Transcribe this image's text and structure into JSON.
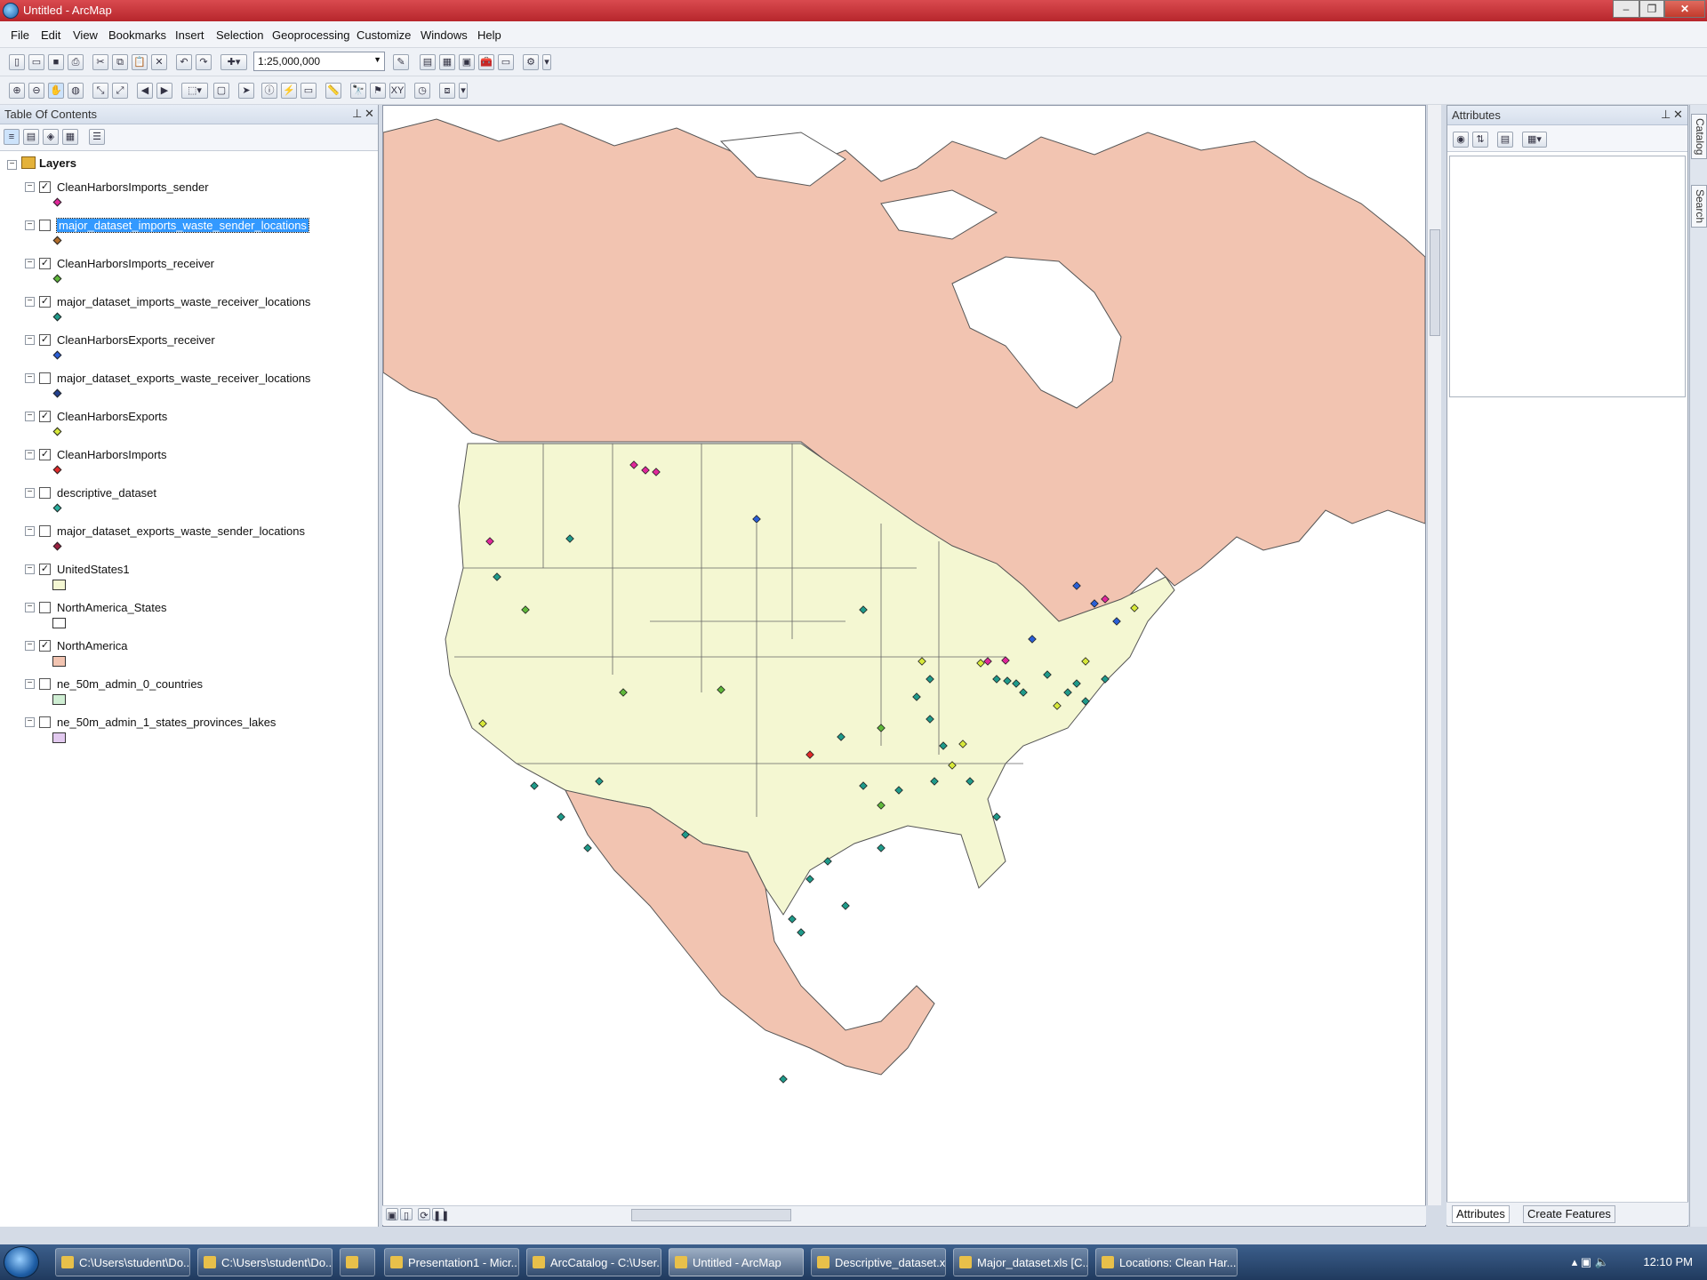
{
  "window": {
    "title": "Untitled - ArcMap"
  },
  "menu": [
    "File",
    "Edit",
    "View",
    "Bookmarks",
    "Insert",
    "Selection",
    "Geoprocessing",
    "Customize",
    "Windows",
    "Help"
  ],
  "toolbar": {
    "scale": "1:25,000,000"
  },
  "toc": {
    "title": "Table Of Contents",
    "root": "Layers",
    "layers": [
      {
        "name": "CleanHarborsImports_sender",
        "checked": true,
        "symbol": "point",
        "color": "#e0279a"
      },
      {
        "name": "major_dataset_imports_waste_sender_locations",
        "checked": false,
        "symbol": "point",
        "color": "#b06c2a",
        "selected": true
      },
      {
        "name": "CleanHarborsImports_receiver",
        "checked": true,
        "symbol": "point",
        "color": "#5fb83a"
      },
      {
        "name": "major_dataset_imports_waste_receiver_locations",
        "checked": true,
        "symbol": "point",
        "color": "#1f9a8a"
      },
      {
        "name": "CleanHarborsExports_receiver",
        "checked": true,
        "symbol": "point",
        "color": "#2a5fd6"
      },
      {
        "name": "major_dataset_exports_waste_receiver_locations",
        "checked": false,
        "symbol": "point",
        "color": "#23408f"
      },
      {
        "name": "CleanHarborsExports",
        "checked": true,
        "symbol": "point",
        "color": "#d7e83a"
      },
      {
        "name": "CleanHarborsImports",
        "checked": true,
        "symbol": "point",
        "color": "#e02a2a"
      },
      {
        "name": "descriptive_dataset",
        "checked": false,
        "symbol": "point",
        "color": "#2ab0a0"
      },
      {
        "name": "major_dataset_exports_waste_sender_locations",
        "checked": false,
        "symbol": "point",
        "color": "#9a1f3f"
      },
      {
        "name": "UnitedStates1",
        "checked": true,
        "symbol": "polygon",
        "color": "#f4f7d2"
      },
      {
        "name": "NorthAmerica_States",
        "checked": false,
        "symbol": "polygon",
        "color": "#ffffff"
      },
      {
        "name": "NorthAmerica",
        "checked": true,
        "symbol": "polygon",
        "color": "#f2c4b1"
      },
      {
        "name": "ne_50m_admin_0_countries",
        "checked": false,
        "symbol": "polygon",
        "color": "#cfeed3"
      },
      {
        "name": "ne_50m_admin_1_states_provinces_lakes",
        "checked": false,
        "symbol": "polygon",
        "color": "#e2c9ef"
      }
    ]
  },
  "attributes": {
    "title": "Attributes",
    "tabs": [
      "Attributes",
      "Create Features"
    ]
  },
  "side_tabs": [
    "Catalog",
    "Search"
  ],
  "map": {
    "colors": {
      "water": "#ffffff",
      "northamerica": "#f2c4b1",
      "us": "#f4f7d2",
      "outline": "#555555"
    }
  },
  "taskbar": {
    "items": [
      "C:\\Users\\student\\Do...",
      "C:\\Users\\student\\Do...",
      "",
      "Presentation1 - Micr...",
      "ArcCatalog - C:\\User...",
      "Untitled - ArcMap",
      "Descriptive_dataset.x...",
      "Major_dataset.xls [C...",
      "Locations: Clean Har..."
    ],
    "clock": "12:10 PM"
  }
}
